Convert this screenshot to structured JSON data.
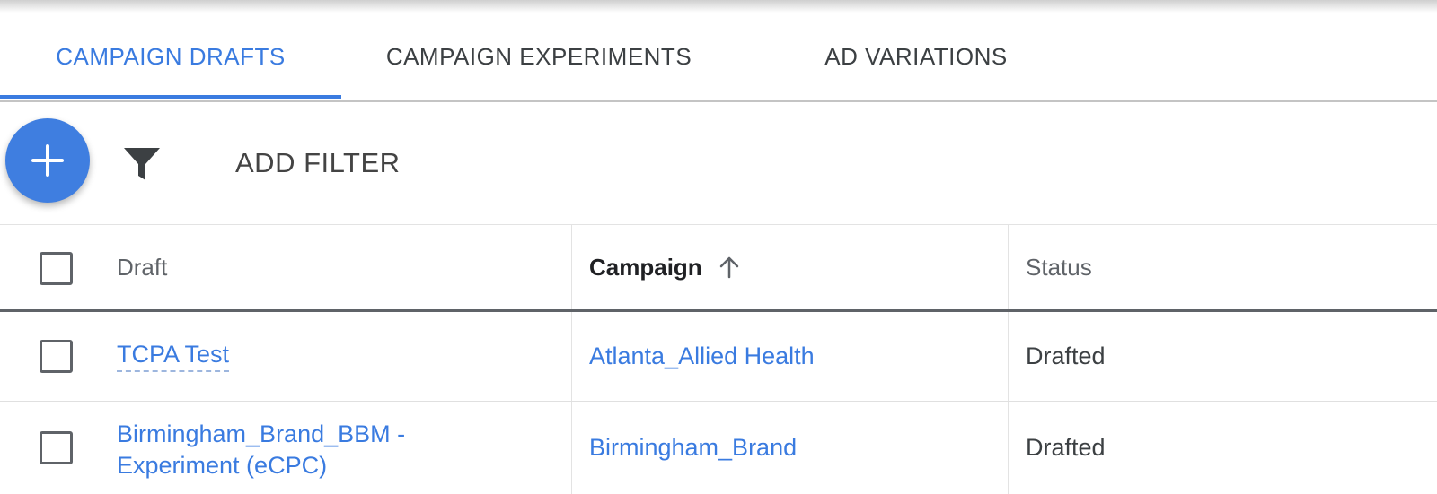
{
  "tabs": [
    {
      "label": "CAMPAIGN DRAFTS",
      "active": true
    },
    {
      "label": "CAMPAIGN EXPERIMENTS",
      "active": false
    },
    {
      "label": "AD VARIATIONS",
      "active": false
    }
  ],
  "toolbar": {
    "add_icon": "plus-icon",
    "filter_icon": "filter-funnel-icon",
    "add_filter_label": "ADD FILTER"
  },
  "table": {
    "columns": [
      {
        "label": "Draft",
        "sorted": false
      },
      {
        "label": "Campaign",
        "sorted": true,
        "sort_direction": "ascending"
      },
      {
        "label": "Status",
        "sorted": false
      }
    ],
    "rows": [
      {
        "draft": "TCPA Test",
        "campaign": "Atlanta_Allied Health",
        "status": "Drafted"
      },
      {
        "draft_line1": "Birmingham_Brand_BBM -",
        "draft_line2": "Experiment (eCPC)",
        "campaign": "Birmingham_Brand",
        "status": "Drafted"
      }
    ]
  },
  "colors": {
    "accent": "#3a7be0",
    "fab": "#3f7ee0",
    "text": "#3c4043"
  }
}
